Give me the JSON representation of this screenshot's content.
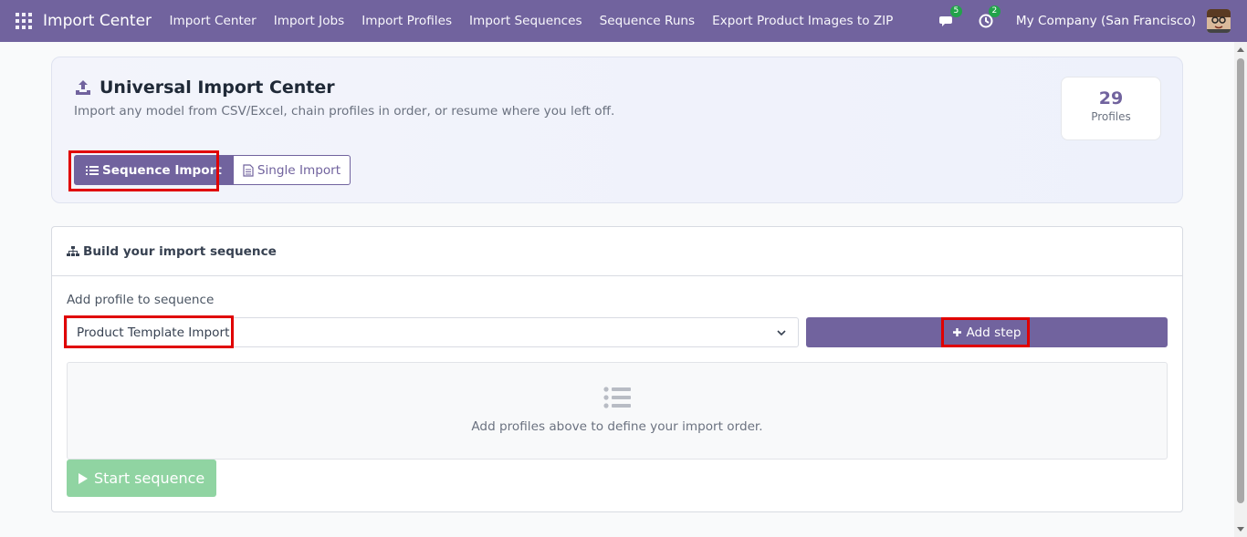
{
  "navbar": {
    "brand": "Import Center",
    "items": [
      {
        "label": "Import Center"
      },
      {
        "label": "Import Jobs"
      },
      {
        "label": "Import Profiles"
      },
      {
        "label": "Import Sequences"
      },
      {
        "label": "Sequence Runs"
      },
      {
        "label": "Export Product Images to ZIP"
      }
    ],
    "messages_count": "5",
    "activities_count": "2",
    "company": "My Company (San Francisco)"
  },
  "hero": {
    "title": "Universal Import Center",
    "subtitle": "Import any model from CSV/Excel, chain profiles in order, or resume where you left off.",
    "stat_value": "29",
    "stat_label": "Profiles",
    "sequence_button": "Sequence Import",
    "single_button": "Single Import"
  },
  "build": {
    "header": "Build your import sequence",
    "field_label": "Add profile to sequence",
    "selected_profile": "Product Template Import",
    "add_step_button": "Add step",
    "empty_message": "Add profiles above to define your import order.",
    "start_button": "Start sequence"
  },
  "colors": {
    "brand": "#71639e",
    "badge": "#22a34a",
    "start_disabled": "#90d4a2",
    "highlight": "#e00000"
  }
}
